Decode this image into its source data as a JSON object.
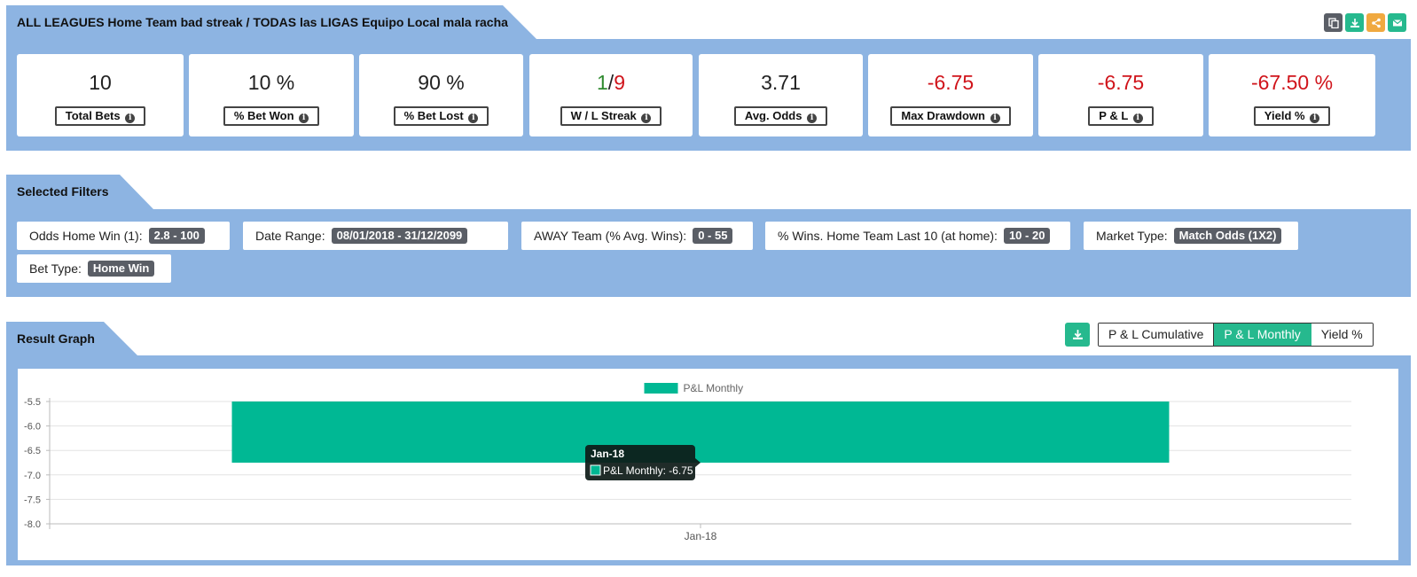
{
  "header": {
    "title": "ALL LEAGUES Home Team bad streak / TODAS las LIGAS Equipo Local mala racha",
    "icons": [
      "copy-icon",
      "download-icon",
      "share-icon",
      "email-icon"
    ],
    "icon_colors": [
      "#5a5e66",
      "#26b98e",
      "#f0a940",
      "#26b98e"
    ]
  },
  "stats": [
    {
      "value": "10",
      "label": "Total Bets"
    },
    {
      "value": "10 %",
      "label": "% Bet Won"
    },
    {
      "value": "90 %",
      "label": "% Bet Lost"
    },
    {
      "value_w": "1",
      "value_sep": "/",
      "value_l": "9",
      "label": "W / L Streak"
    },
    {
      "value": "3.71",
      "label": "Avg. Odds"
    },
    {
      "value": "-6.75",
      "label": "Max Drawdown"
    },
    {
      "value": "-6.75",
      "label": "P & L"
    },
    {
      "value": "-67.50 %",
      "label": "Yield %"
    }
  ],
  "filters": {
    "section_title": "Selected Filters",
    "items": [
      {
        "label": "Odds Home Win (1):",
        "value": "2.8 - 100"
      },
      {
        "label": "Date Range:",
        "value": "08/01/2018 - 31/12/2099"
      },
      {
        "label": "AWAY Team (% Avg. Wins):",
        "value": "0 - 55"
      },
      {
        "label": "% Wins. Home Team Last 10 (at home):",
        "value": "10 - 20"
      },
      {
        "label": "Market Type:",
        "value": "Match Odds (1X2)"
      },
      {
        "label": "Bet Type:",
        "value": "Home Win"
      }
    ]
  },
  "graph": {
    "section_title": "Result Graph",
    "buttons": [
      "P & L Cumulative",
      "P & L Monthly",
      "Yield %"
    ],
    "active_button": "P & L Monthly",
    "tooltip": {
      "title": "Jan-18",
      "text": "P&L Monthly: -6.75"
    }
  },
  "colors": {
    "accent": "#26b98e",
    "band": "#8db4e2",
    "negative": "#d0141b",
    "positive": "#2f8a2f"
  },
  "chart_data": {
    "type": "bar",
    "categories": [
      "Jan-18"
    ],
    "series": [
      {
        "name": "P&L Monthly",
        "values": [
          -6.75
        ],
        "color": "#00b894"
      }
    ],
    "yticks": [
      -5.5,
      -6.0,
      -6.5,
      -7.0,
      -7.5,
      -8.0
    ],
    "ytick_labels": [
      "-5.5",
      "-6.0",
      "-6.5",
      "-7.0",
      "-7.5",
      "-8.0"
    ],
    "ylim": [
      -8.0,
      -5.5
    ],
    "legend": "top-center",
    "grid": true
  }
}
